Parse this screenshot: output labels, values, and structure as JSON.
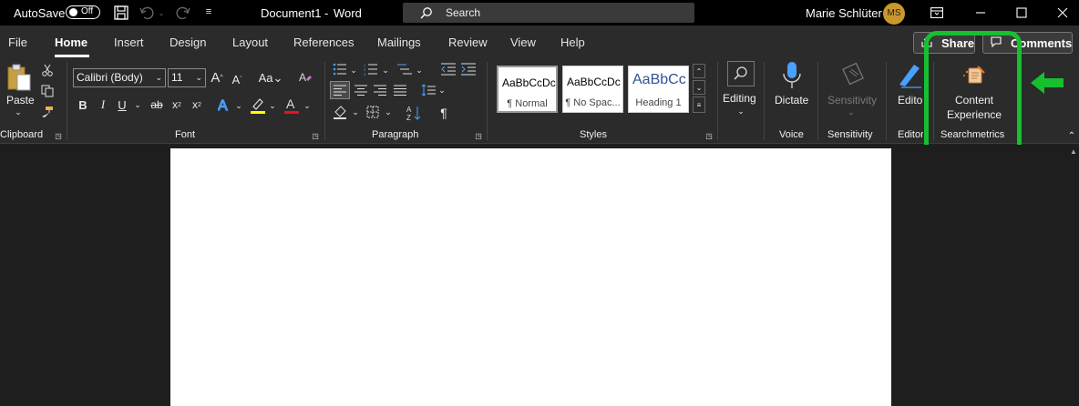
{
  "titlebar": {
    "autosave_label": "AutoSave",
    "autosave_state": "Off",
    "doc_title": "Document1",
    "separator": "-",
    "app_name": "Word",
    "search_placeholder": "Search",
    "user_name": "Marie Schlüter",
    "user_initials": "MS"
  },
  "tabs": [
    "File",
    "Home",
    "Insert",
    "Design",
    "Layout",
    "References",
    "Mailings",
    "Review",
    "View",
    "Help"
  ],
  "active_tab": "Home",
  "actions": {
    "share": "Share",
    "comments": "Comments"
  },
  "clipboard": {
    "paste_label": "Paste",
    "group_label": "Clipboard"
  },
  "font": {
    "name": "Calibri (Body)",
    "size": "11",
    "group_label": "Font"
  },
  "paragraph": {
    "group_label": "Paragraph"
  },
  "styles": {
    "group_label": "Styles",
    "items": [
      {
        "sample": "AaBbCcDc",
        "name": "¶ Normal"
      },
      {
        "sample": "AaBbCcDc",
        "name": "¶ No Spac..."
      },
      {
        "sample": "AaBbCc",
        "name": "Heading 1"
      }
    ]
  },
  "editing": {
    "label": "Editing"
  },
  "voice": {
    "dictate_label": "Dictate",
    "group_label": "Voice"
  },
  "sensitivity": {
    "button_label": "Sensitivity",
    "group_label": "Sensitivity"
  },
  "editor": {
    "button_label": "Editor",
    "group_label": "Editor"
  },
  "searchmetrics": {
    "line1": "Content",
    "line2": "Experience",
    "group_label": "Searchmetrics"
  },
  "colors": {
    "accent_highlight": "#16c02f",
    "font_color": "#e81123",
    "highlight_color": "#ffff00",
    "avatar": "#c9982d"
  }
}
